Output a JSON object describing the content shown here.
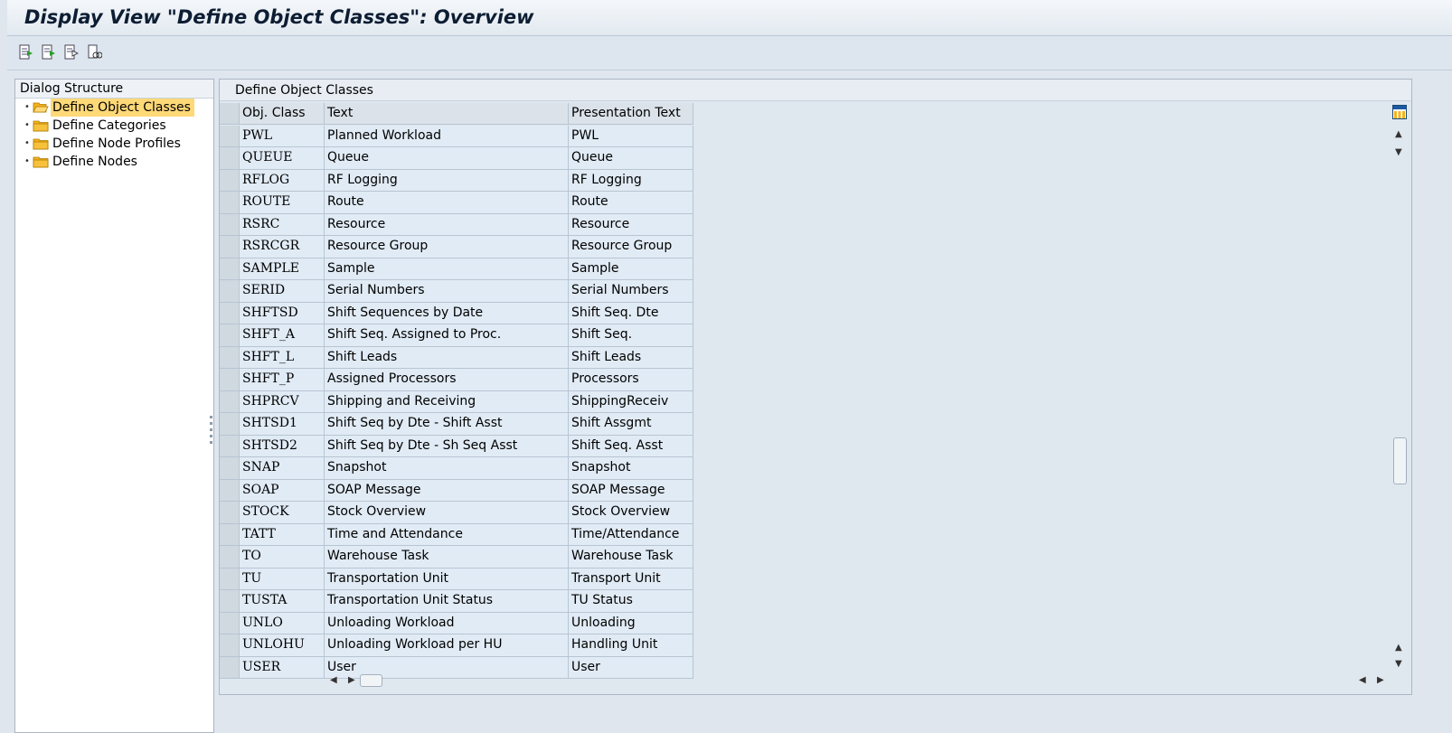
{
  "title": "Display View \"Define Object Classes\": Overview",
  "toolbar": {
    "buttons": [
      {
        "name": "expand-icon"
      },
      {
        "name": "collapse-icon"
      },
      {
        "name": "select-icon"
      },
      {
        "name": "find-icon"
      }
    ]
  },
  "dialog_structure": {
    "header": "Dialog Structure",
    "items": [
      {
        "label": "Define Object Classes",
        "selected": true
      },
      {
        "label": "Define Categories",
        "selected": false
      },
      {
        "label": "Define Node Profiles",
        "selected": false
      },
      {
        "label": "Define Nodes",
        "selected": false
      }
    ]
  },
  "main": {
    "header": "Define Object Classes",
    "columns": [
      "Obj. Class",
      "Text",
      "Presentation Text"
    ],
    "rows": [
      [
        "PWL",
        "Planned Workload",
        "PWL"
      ],
      [
        "QUEUE",
        "Queue",
        "Queue"
      ],
      [
        "RFLOG",
        "RF Logging",
        "RF Logging"
      ],
      [
        "ROUTE",
        "Route",
        "Route"
      ],
      [
        "RSRC",
        "Resource",
        "Resource"
      ],
      [
        "RSRCGR",
        "Resource Group",
        "Resource Group"
      ],
      [
        "SAMPLE",
        "Sample",
        "Sample"
      ],
      [
        "SERID",
        "Serial Numbers",
        "Serial Numbers"
      ],
      [
        "SHFTSD",
        "Shift Sequences by Date",
        "Shift Seq. Dte"
      ],
      [
        "SHFT_A",
        "Shift Seq. Assigned to Proc.",
        "Shift Seq."
      ],
      [
        "SHFT_L",
        "Shift Leads",
        "Shift Leads"
      ],
      [
        "SHFT_P",
        "Assigned Processors",
        "Processors"
      ],
      [
        "SHPRCV",
        "Shipping and Receiving",
        "ShippingReceiv"
      ],
      [
        "SHTSD1",
        "Shift Seq by Dte - Shift Asst",
        "Shift Assgmt"
      ],
      [
        "SHTSD2",
        "Shift Seq by Dte - Sh Seq Asst",
        "Shift Seq. Asst"
      ],
      [
        "SNAP",
        "Snapshot",
        "Snapshot"
      ],
      [
        "SOAP",
        "SOAP Message",
        "SOAP Message"
      ],
      [
        "STOCK",
        "Stock Overview",
        "Stock Overview"
      ],
      [
        "TATT",
        "Time and Attendance",
        "Time/Attendance"
      ],
      [
        "TO",
        "Warehouse Task",
        "Warehouse Task"
      ],
      [
        "TU",
        "Transportation Unit",
        "Transport Unit"
      ],
      [
        "TUSTA",
        "Transportation Unit Status",
        "TU Status"
      ],
      [
        "UNLO",
        "Unloading Workload",
        "Unloading"
      ],
      [
        "UNLOHU",
        "Unloading Workload per HU",
        "Handling Unit"
      ],
      [
        "USER",
        "User",
        "User"
      ]
    ]
  },
  "colors": {
    "selected_tree_bg": "#ffd978",
    "folder": "#f5b21c",
    "cell_bg": "#e1ebf5"
  }
}
